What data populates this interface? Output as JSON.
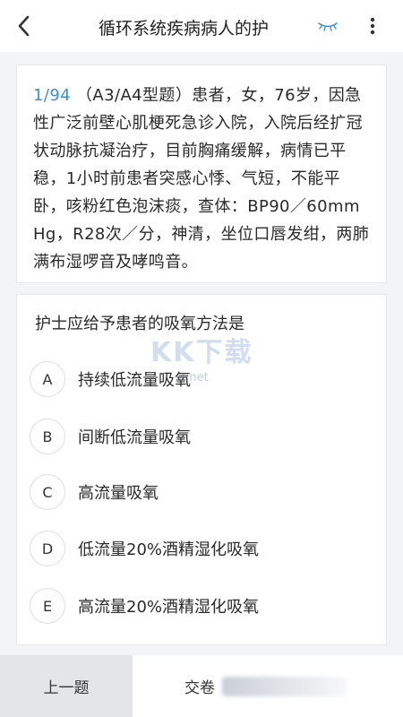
{
  "header": {
    "title": "循环系统疾病病人的护"
  },
  "stem": {
    "index": "1/94",
    "text": "（A3/A4型题）患者，女，76岁，因急性广泛前壁心肌梗死急诊入院，入院后经扩冠状动脉抗凝治疗，目前胸痛缓解，病情已平稳，1小时前患者突感心悸、气短，不能平卧，咳粉红色泡沫痰，查体：BP90／60mmHg，R28次／分，神清，坐位口唇发绀，两肺满布湿啰音及哮鸣音。"
  },
  "question": "护士应给予患者的吸氧方法是",
  "options": [
    {
      "letter": "A",
      "text": "持续低流量吸氧"
    },
    {
      "letter": "B",
      "text": "间断低流量吸氧"
    },
    {
      "letter": "C",
      "text": "高流量吸氧"
    },
    {
      "letter": "D",
      "text": "低流量20%酒精湿化吸氧"
    },
    {
      "letter": "E",
      "text": "高流量20%酒精湿化吸氧"
    }
  ],
  "watermark": {
    "main": "KK下载",
    "sub": "c.net"
  },
  "footer": {
    "prev_label": "上一题",
    "submit_label": "交卷"
  },
  "colors": {
    "accent": "#3b8fd9",
    "eye_icon": "#3b8fd9"
  }
}
